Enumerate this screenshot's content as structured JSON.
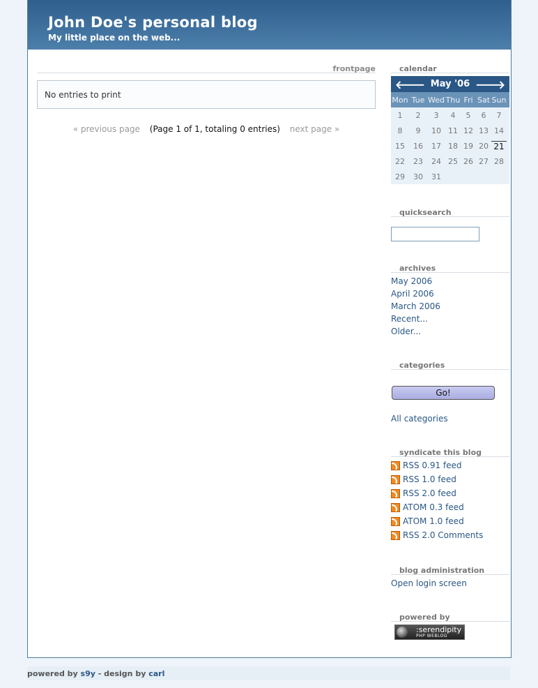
{
  "header": {
    "title": "John Doe's personal blog",
    "description": "My little place on the web..."
  },
  "main": {
    "section_label": "frontpage",
    "entries_message": "No entries to print",
    "pager": {
      "previous": "« previous page",
      "info": "(Page 1 of 1, totaling 0 entries)",
      "next": "next page »"
    }
  },
  "sidebar": {
    "calendar": {
      "heading": "calendar",
      "prev_arrow": "🡐",
      "month_label": "May '06",
      "next_arrow": "🡒",
      "weekdays": [
        "Mon",
        "Tue",
        "Wed",
        "Thu",
        "Fri",
        "Sat",
        "Sun"
      ],
      "weeks": [
        [
          "1",
          "2",
          "3",
          "4",
          "5",
          "6",
          "7"
        ],
        [
          "8",
          "9",
          "10",
          "11",
          "12",
          "13",
          "14"
        ],
        [
          "15",
          "16",
          "17",
          "18",
          "19",
          "20",
          "21"
        ],
        [
          "22",
          "23",
          "24",
          "25",
          "26",
          "27",
          "28"
        ],
        [
          "29",
          "30",
          "31",
          "",
          "",
          "",
          ""
        ]
      ],
      "today": "21"
    },
    "quicksearch": {
      "heading": "quicksearch",
      "value": ""
    },
    "archives": {
      "heading": "archives",
      "items": [
        "May 2006",
        "April 2006",
        "March 2006",
        "Recent...",
        "Older..."
      ]
    },
    "categories": {
      "heading": "categories",
      "go_label": "Go!",
      "all_label": "All categories"
    },
    "syndicate": {
      "heading": "syndicate this blog",
      "feeds": [
        "RSS 0.91 feed",
        "RSS 1.0 feed",
        "RSS 2.0 feed",
        "ATOM 0.3 feed",
        "ATOM 1.0 feed",
        "RSS 2.0 Comments"
      ]
    },
    "admin": {
      "heading": "blog administration",
      "login_label": "Open login screen"
    },
    "powered": {
      "heading": "powered by",
      "badge_line1": ":serendipity",
      "badge_line2": "PHP WEBLOG"
    }
  },
  "footer": {
    "powered_prefix": "powered by",
    "s9y_link": "s9y",
    "design_prefix": "- design by",
    "designer_link": "carl"
  },
  "colors": {
    "banner": "#2f5f8d",
    "link": "#2a5785",
    "calendar_header": "#2a5785",
    "calendar_bg": "#e9f1f8"
  }
}
